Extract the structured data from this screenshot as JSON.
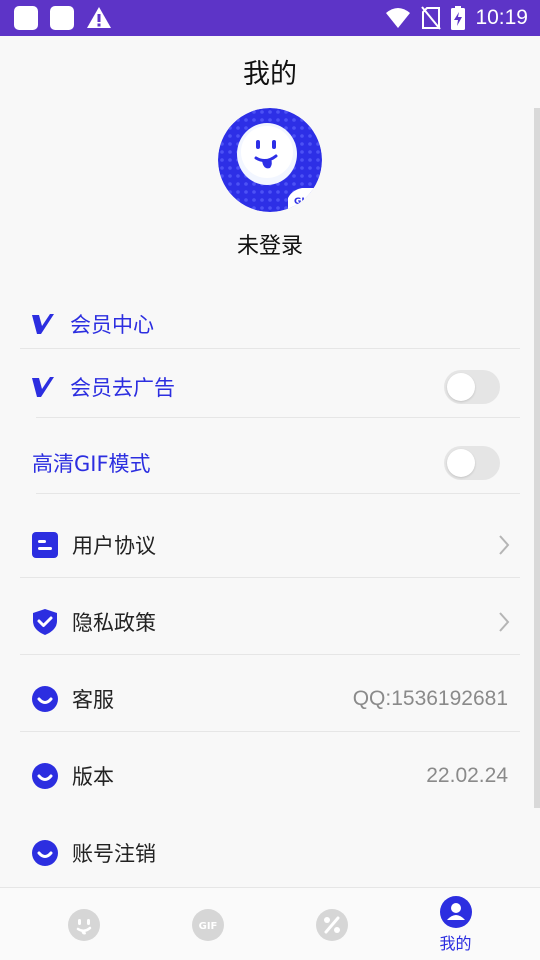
{
  "status_bar": {
    "time": "10:19",
    "icons": [
      "app-icon",
      "app-icon",
      "warning-icon",
      "wifi-icon",
      "no-sim-icon",
      "battery-charging-icon"
    ]
  },
  "header": {
    "title": "我的"
  },
  "profile": {
    "avatar_icon": "gif-mascot-avatar",
    "login_status": "未登录"
  },
  "menu": {
    "vip_center": {
      "label": "会员中心",
      "icon": "vip-v-icon"
    },
    "vip_remove_ads": {
      "label": "会员去广告",
      "icon": "vip-v-icon",
      "toggle_on": false
    },
    "hd_gif_mode": {
      "label": "高清GIF模式",
      "toggle_on": false
    },
    "user_agreement": {
      "label": "用户协议",
      "icon": "document-icon"
    },
    "privacy_policy": {
      "label": "隐私政策",
      "icon": "shield-check-icon"
    },
    "customer_service": {
      "label": "客服",
      "icon": "smile-icon",
      "value": "QQ:1536192681"
    },
    "version": {
      "label": "版本",
      "icon": "smile-icon",
      "value": "22.02.24"
    },
    "delete_account": {
      "label": "账号注销",
      "icon": "smile-icon"
    }
  },
  "bottom_nav": {
    "items": [
      {
        "icon": "face-icon",
        "label": ""
      },
      {
        "icon": "gif-icon",
        "label": ""
      },
      {
        "icon": "percent-icon",
        "label": ""
      },
      {
        "icon": "person-icon",
        "label": "我的",
        "active": true
      }
    ]
  },
  "colors": {
    "accent": "#2c2ee0",
    "status_bar": "#5d34c7",
    "inactive_icon": "#d6d6d6",
    "value_text": "#8a8a8a"
  }
}
